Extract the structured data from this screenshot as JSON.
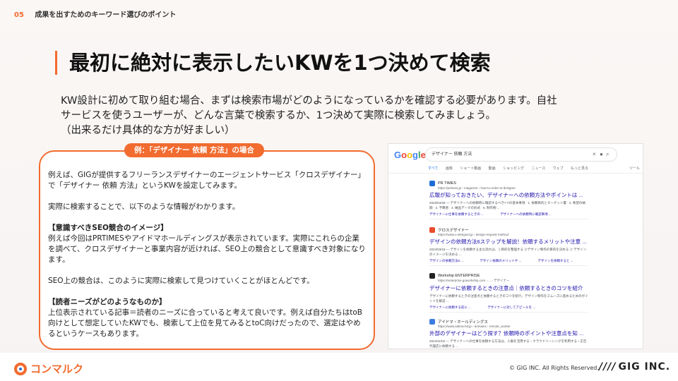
{
  "header": {
    "section_number": "05",
    "section_title": "成果を出すためのキーワード選びのポイント"
  },
  "headline": "最初に絶対に表示したいKWを1つ決めて検索",
  "intro": [
    "KW設計に初めて取り組む場合、まずは検索市場がどのようになっているかを確認する必要があります。自社",
    "サービスを使うユーザーが、どんな言葉で検索するか、1つ決めて実際に検索してみましょう。",
    "（出来るだけ具体的な方が好ましい）"
  ],
  "case": {
    "label": "例：「デザイナー 依頼 方法」の場合",
    "p1": "例えば、GIGが提供するフリーランスデザイナーのエージェントサービス「クロスデザイナー」で「デザイナー 依頼 方法」というKWを設定してみます。",
    "p2": "実際に検索することで、以下のような情報がわかります。",
    "h3": "【意識すべきSEO競合のイメージ】",
    "p3": "例えば今回はPRTIMESやアイドマホールディングスが表示されています。実際にこれらの企業を調べて、クロスデザイナーと事業内容が近ければ、SEO上の競合として意識すべき対象になります。",
    "p4": "SEO上の競合は、このように実際に検索して見つけていくことがほとんどです。",
    "h5": "【読者ニーズがどのようなものか】",
    "p5": "上位表示されている記事＝読者のニーズに合っていると考えて良いです。例えば自分たちはtoB向けとして想定していたKWでも、検索して上位を見てみるとtoC向けだったので、選定はやめるというケースもあります。"
  },
  "serp": {
    "logo": [
      "G",
      "o",
      "o",
      "g",
      "l",
      "e"
    ],
    "query": "デザイナー 依頼 方法",
    "tabs": [
      "すべて",
      "画像",
      "ショート動画",
      "動画",
      "ショッピング",
      "ニュース",
      "ウェブ",
      "もっと見る"
    ],
    "tools": "ツール",
    "results": [
      {
        "site": "PR TIMES",
        "url": "https://prtimes.jp › magazine › how-to-order-to-designer",
        "title": "広報が知っておきたい、デザイナーへの依頼方法やポイントは ...",
        "snippet": "2023/04/28 — デザイナーへの依頼時に確認するべき7つの基本事項 · 1. 依頼目的とターゲット層 · 2. 希望の納期 · 3. 予算感 · 4. 納品データの形式 · 5. 制作物 ...",
        "links": [
          "デザイナーに仕事を依頼するときの ...",
          "デザイナーへの依頼時に確認事項 ..."
        ],
        "fav_color": "#1e6bd6"
      },
      {
        "site": "クロスデザイナー",
        "url": "https://www.x-designer.jp › design-request-method",
        "title": "デザインの依頼方法6ステップを解説！依頼するメリットや注意 ...",
        "snippet": "2024/03/18 — デザインを依頼する主な流れは、①目的を整理する ②デザイン制作の目的を決める ③ デザインのイメージを決める ...",
        "links": [
          "デザインの依頼方法6 ...",
          "デザイン依頼のメリットや ...",
          "デザインを依頼すると ..."
        ],
        "fav_color": "#e84b2d"
      },
      {
        "site": "Workship ENTERPRISE",
        "url": "https://enterprise.goworkship.com › ... › デザイナー",
        "title": "デザイナーに依頼するときの注意点｜依頼するときのコツを紹介",
        "snippet": "デザイナーに依頼するときの注意点と依頼するときのコツを紹介。デザイン制作をスムーズに進めるためのポイントを解説 ...",
        "links": [
          "デザイナーに依頼する前に ...",
          "デザイナーに対してアピールを ..."
        ],
        "fav_color": "#222222"
      },
      {
        "site": "アイドマ・ホールディングス",
        "url": "https://www.aidma-hd.jp › domains › remote_worker",
        "title": "外部のデザイナーはどう探す？依頼時のポイントや注意点を知 ...",
        "snippet": "2024/11/04 — デザイナーへの仕事を依頼する方法は、人脈を活用する・クラウドソーシングを利用する・広告代理店に依頼する ...",
        "links": [],
        "fav_color": "#3d7be0"
      }
    ]
  },
  "footer": {
    "brand": "コンマルク",
    "copyright": "© GIG INC. All Rights Reserved.",
    "logo_text": "GIG INC.",
    "logo_stripes": "////"
  }
}
